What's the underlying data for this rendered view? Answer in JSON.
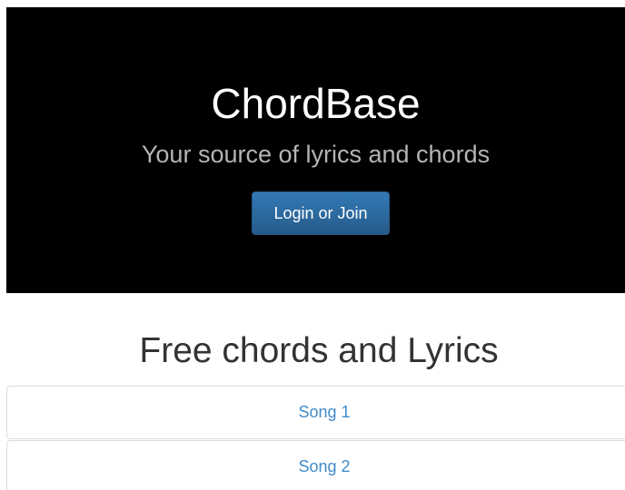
{
  "hero": {
    "title": "ChordBase",
    "tagline": "Your source of lyrics and chords",
    "login_label": "Login or Join"
  },
  "section": {
    "title": "Free chords and Lyrics"
  },
  "songs": [
    {
      "label": "Song 1"
    },
    {
      "label": "Song 2"
    }
  ],
  "colors": {
    "hero_background": "#000000",
    "button_primary": "#337ab7",
    "link": "#428bca"
  }
}
